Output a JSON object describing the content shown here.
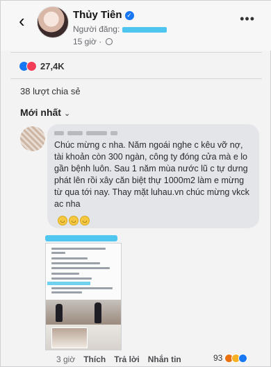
{
  "header": {
    "name": "Thủy Tiên",
    "poster_label": "Người đăng:",
    "time": "15 giờ"
  },
  "reactions": {
    "count": "27,4K"
  },
  "shares": {
    "label": "38 lượt chia sẻ"
  },
  "sort": {
    "label": "Mới nhất"
  },
  "comment": {
    "text": "Chúc mừng c nha. Năm ngoái nghe c kêu vỡ nợ, tài khoản còn 300 ngàn, công ty đóng cửa mà e lo gần bệnh luôn. Sau 1 năm mùa nước lũ c tự dưng phát lên rồi xây căn biệt thự 1000m2 làm e mừng từ qua tới nay. Thay mặt luhau.vn chúc mừng vkck ac nha"
  },
  "actions": {
    "time": "3 giờ",
    "like": "Thích",
    "reply": "Trả lời",
    "message": "Nhắn tin",
    "reaction_count": "93"
  },
  "colors": {
    "like": "#1877f2",
    "love": "#f33e58",
    "redaction": "#4fc6f0"
  },
  "icons": [
    "back-arrow-icon",
    "verified-icon",
    "globe-icon",
    "more-icon",
    "chevron-down-icon",
    "like-reaction-icon",
    "love-reaction-icon",
    "emoji-icon"
  ]
}
